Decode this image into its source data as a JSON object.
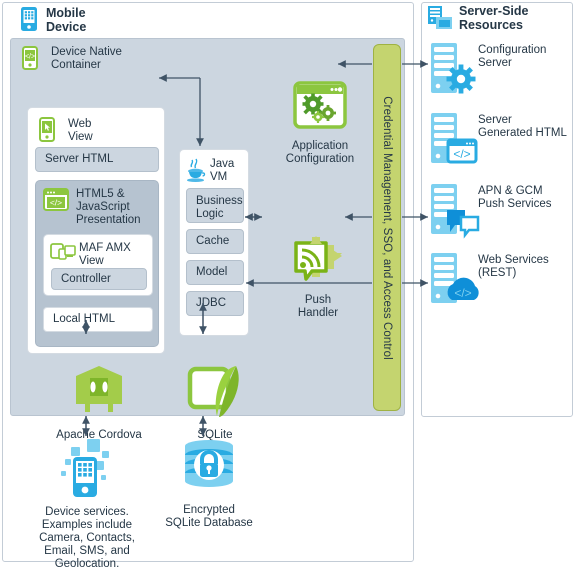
{
  "panels": {
    "mobile_device": {
      "title": "Mobile\nDevice",
      "icon": "mobile-phone-icon"
    },
    "server_side": {
      "title": "Server-Side\nResources",
      "icon": "server-stack-icon"
    }
  },
  "device_native_container": {
    "title": "Device Native\nContainer",
    "icon": "device-code-icon",
    "web_view": {
      "title": "Web\nView",
      "icon": "webview-cursor-icon",
      "server_html": "Server HTML",
      "local_html": "Local HTML",
      "html5_presentation": {
        "title": "HTML5 &\nJavaScript\nPresentation",
        "icon": "browser-code-icon",
        "maf_amx_view": {
          "title": "MAF AMX\nView",
          "icon": "responsive-devices-icon",
          "controller": "Controller"
        }
      }
    },
    "java_vm": {
      "title": "Java\nVM",
      "icon": "java-coffee-cup-icon",
      "items": [
        "Business\nLogic",
        "Cache",
        "Model",
        "JDBC"
      ]
    },
    "application_configuration": {
      "label": "Application\nConfiguration",
      "icon": "gears-window-icon"
    },
    "push_handler": {
      "label": "Push\nHandler",
      "icon": "push-broadcast-icon"
    },
    "apache_cordova": {
      "label": "Apache Cordova",
      "icon": "cordova-robot-icon"
    },
    "sqlite": {
      "label": "SQLite",
      "icon": "sqlite-feather-icon"
    }
  },
  "bottom_nodes": {
    "device_services": {
      "label": "Device services.\nExamples include\nCamera, Contacts,\nEmail, SMS, and\nGeolocation.",
      "icon": "device-services-phone-icon"
    },
    "encrypted_database": {
      "label": "Encrypted\nSQLite Database",
      "icon": "database-lock-icon"
    }
  },
  "credential_bar": {
    "label": "Credential Management, SSO, and Access Control",
    "color": "#c4d46f"
  },
  "server_resources": [
    {
      "label": "Configuration\nServer",
      "icon": "server-gear-icon"
    },
    {
      "label": "Server\nGenerated HTML",
      "icon": "server-code-window-icon"
    },
    {
      "label": "APN & GCM\nPush Services",
      "icon": "server-chat-bubbles-icon"
    },
    {
      "label": "Web Services\n(REST)",
      "icon": "server-cloud-code-icon"
    }
  ],
  "colors": {
    "green": "#8cc63f",
    "green_dark": "#7ab317",
    "blue": "#29abe2",
    "blue_light": "#7dd0f0",
    "panel_bg": "#ccd6e0",
    "grey_box": "#b6c3d0",
    "text": "#253746",
    "line": "#3f5366"
  }
}
